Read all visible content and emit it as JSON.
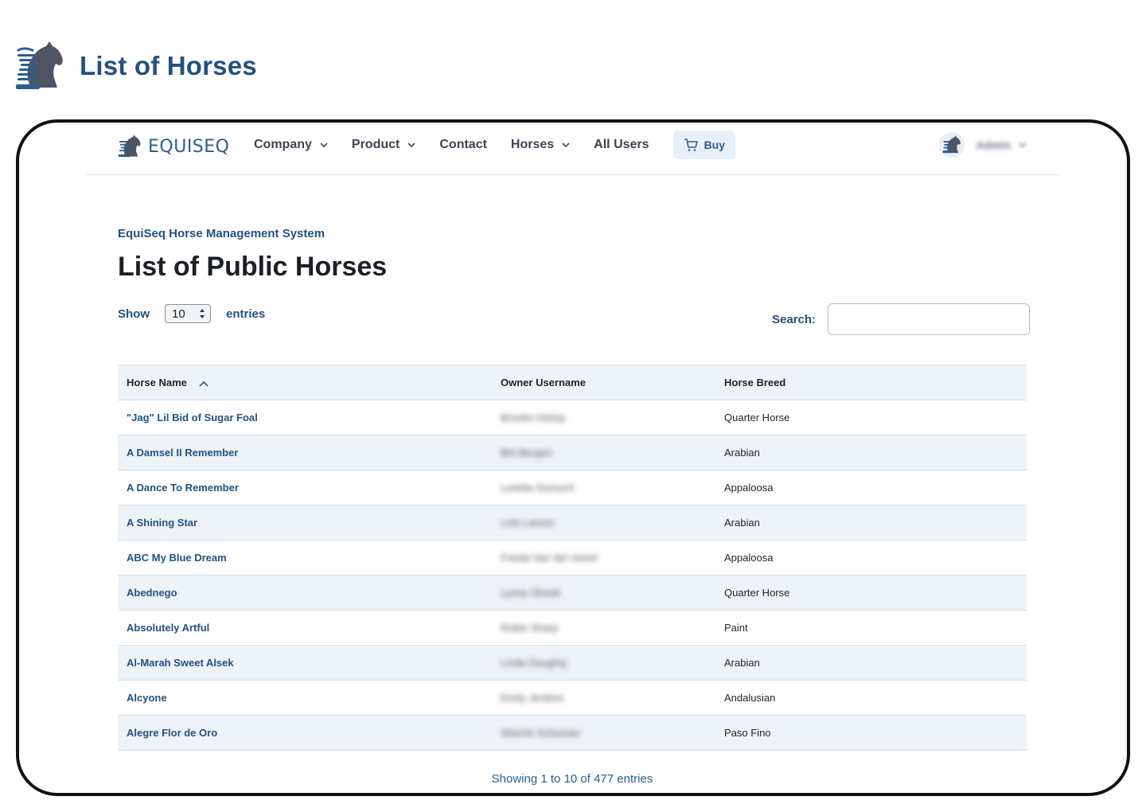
{
  "page": {
    "title": "List of Horses"
  },
  "navbar": {
    "brand": "EQUISEQ",
    "items": [
      {
        "label": "Company",
        "dropdown": true
      },
      {
        "label": "Product",
        "dropdown": true
      },
      {
        "label": "Contact",
        "dropdown": false
      },
      {
        "label": "Horses",
        "dropdown": true
      },
      {
        "label": "All Users",
        "dropdown": false
      }
    ],
    "buy_label": "Buy",
    "user_name": "Admin"
  },
  "main": {
    "subtitle": "EquiSeq Horse Management System",
    "heading": "List of Public Horses",
    "show_label": "Show",
    "entries_value": "10",
    "entries_label": "entries",
    "search_label": "Search:",
    "search_value": ""
  },
  "table": {
    "columns": [
      "Horse Name",
      "Owner Username",
      "Horse Breed"
    ],
    "rows": [
      {
        "name": "\"Jag\" Lil Bid of Sugar Foal",
        "owner": "Brooke Hislop",
        "breed": "Quarter Horse"
      },
      {
        "name": "A Damsel II Remember",
        "owner": "Brit Bergen",
        "breed": "Arabian"
      },
      {
        "name": "A Dance To Remember",
        "owner": "Loretta Gorsuch",
        "breed": "Appaloosa"
      },
      {
        "name": "A Shining Star",
        "owner": "Lele Larson",
        "breed": "Arabian"
      },
      {
        "name": "ABC My Blue Dream",
        "owner": "Frieda Van der merel",
        "breed": "Appaloosa"
      },
      {
        "name": "Abednego",
        "owner": "Lynne Shook",
        "breed": "Quarter Horse"
      },
      {
        "name": "Absolutely Artful",
        "owner": "Robin Sharp",
        "breed": "Paint"
      },
      {
        "name": "Al-Marah Sweet Alsek",
        "owner": "Linda Doughty",
        "breed": "Arabian"
      },
      {
        "name": "Alcyone",
        "owner": "Emily Jenkins",
        "breed": "Andalusian"
      },
      {
        "name": "Alegre Flor de Oro",
        "owner": "Sherrie Schuman",
        "breed": "Paso Fino"
      }
    ]
  },
  "footer": {
    "info": "Showing 1 to 10 of 477 entries"
  },
  "colors": {
    "brand_blue": "#24517f",
    "header_bg": "#eef3f8",
    "buy_bg": "#e7f0f8"
  },
  "icons": {
    "logo": "horse-dna-logo-icon",
    "cart": "cart-icon",
    "chevron": "chevron-down-icon",
    "sort": "sort-ascending-icon"
  }
}
